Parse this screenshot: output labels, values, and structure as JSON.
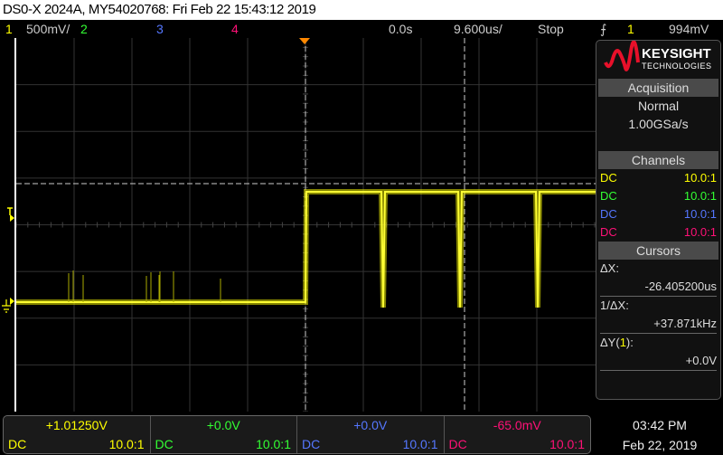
{
  "title": "DS0-X 2024A, MY54020768: Fri Feb 22 15:43:12 2019",
  "topbar": {
    "ch1": "1",
    "ch1_scale": "500mV/",
    "ch2": "2",
    "ch3": "3",
    "ch4": "4",
    "delay": "0.0s",
    "timebase": "9.600us/",
    "run_state": "Stop",
    "trigger_icon": "rising-edge",
    "trigger_source": "1",
    "trigger_level": "994mV"
  },
  "colors": {
    "ch1": "#ffff00",
    "ch2": "#33ff33",
    "ch3": "#5577ff",
    "ch4": "#ff1177"
  },
  "side": {
    "brand": "KEYSIGHT",
    "brand_sub": "TECHNOLOGIES",
    "acquisition": {
      "header": "Acquisition",
      "mode": "Normal",
      "rate": "1.00GSa/s"
    },
    "channels": {
      "header": "Channels",
      "rows": [
        {
          "coupling": "DC",
          "probe": "10.0:1"
        },
        {
          "coupling": "DC",
          "probe": "10.0:1"
        },
        {
          "coupling": "DC",
          "probe": "10.0:1"
        },
        {
          "coupling": "DC",
          "probe": "10.0:1"
        }
      ]
    },
    "cursors": {
      "header": "Cursors",
      "dx_label": "ΔX:",
      "dx": "-26.405200us",
      "inv_label": "1/ΔX:",
      "inv": "+37.871kHz",
      "dy_label": "ΔY(",
      "dy_ch": "1",
      "dy_end": "):",
      "dy": "+0.0V"
    }
  },
  "bottom": [
    {
      "value": "+1.01250V",
      "coupling": "DC",
      "probe": "10.0:1"
    },
    {
      "value": "+0.0V",
      "coupling": "DC",
      "probe": "10.0:1"
    },
    {
      "value": "+0.0V",
      "coupling": "DC",
      "probe": "10.0:1"
    },
    {
      "value": "-65.0mV",
      "coupling": "DC",
      "probe": "10.0:1"
    }
  ],
  "clock": {
    "time": "03:42 PM",
    "date": "Feb 22, 2019"
  }
}
